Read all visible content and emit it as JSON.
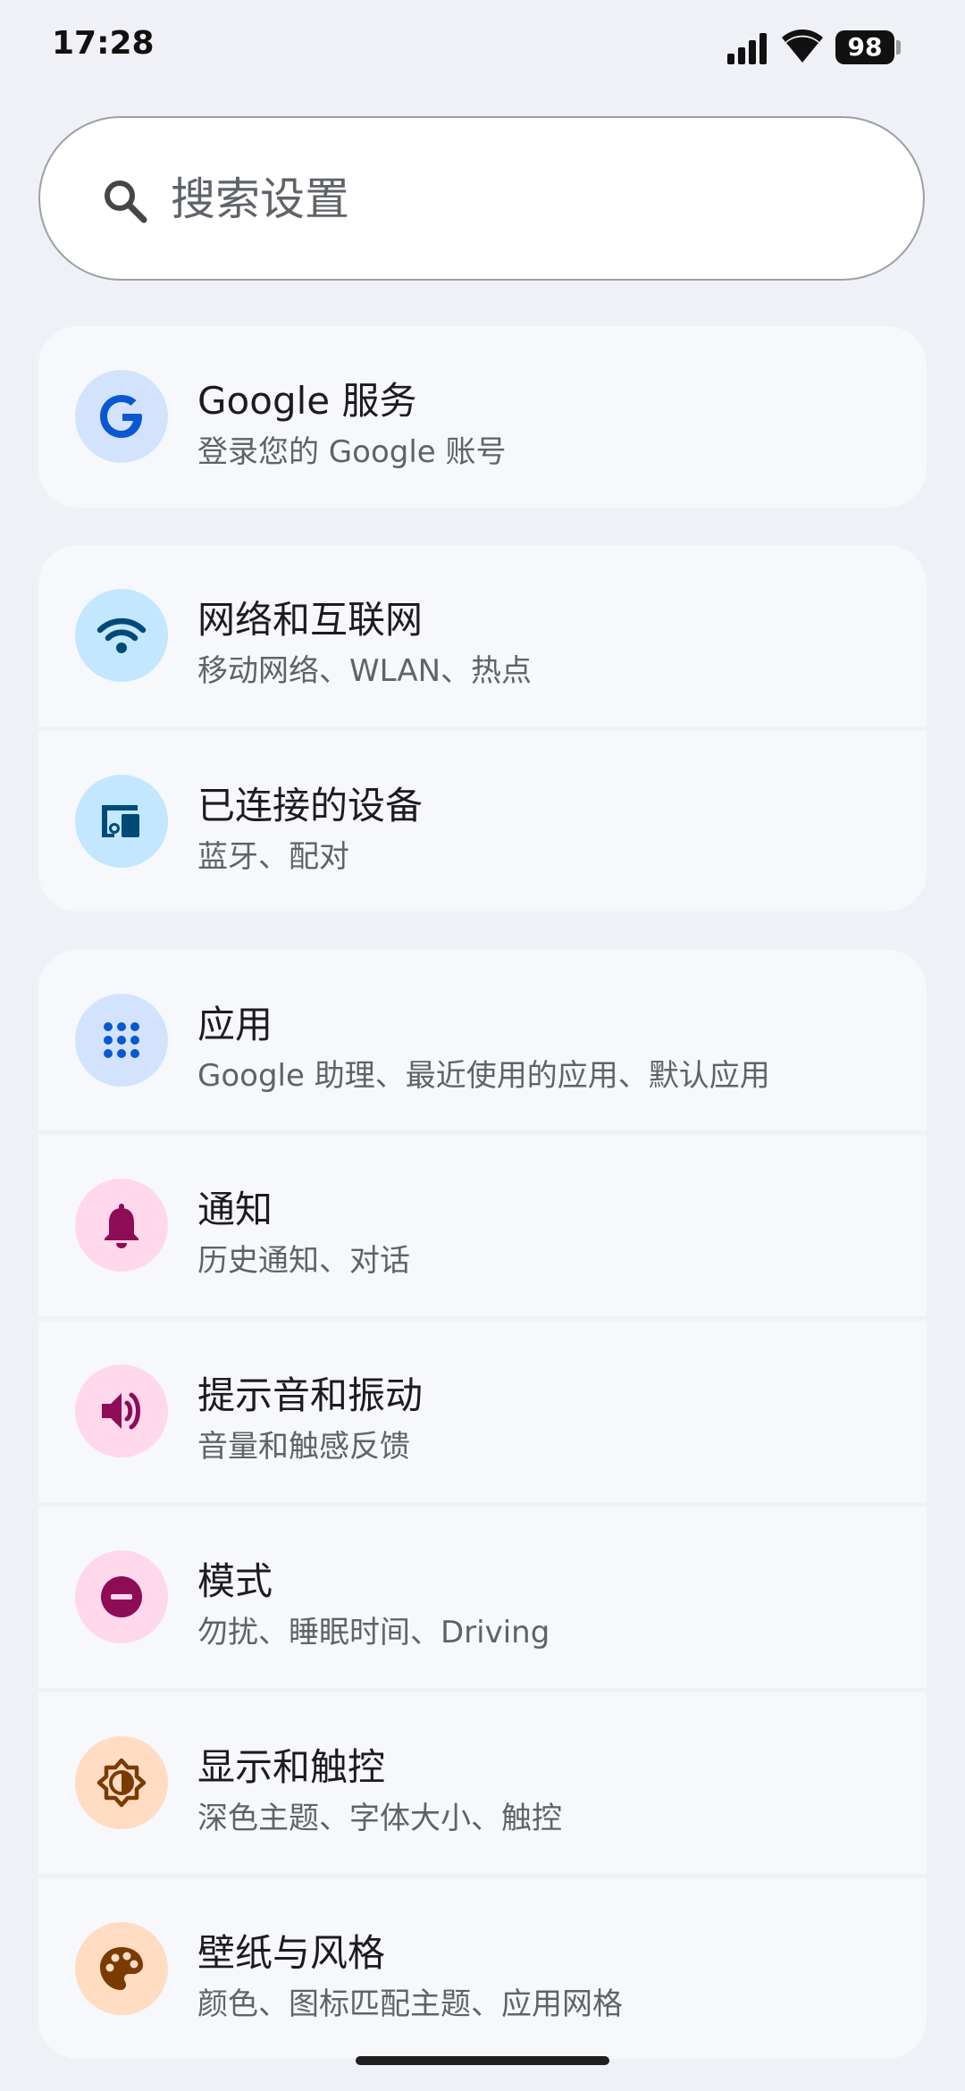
{
  "status_bar": {
    "time": "17:28",
    "battery_level": "98",
    "signal_bars": 4,
    "wifi": "full"
  },
  "search": {
    "placeholder": "搜索设置"
  },
  "settings": {
    "google": {
      "title": "Google 服务",
      "subtitle": "登录您的 Google 账号",
      "icon": "google-g-icon",
      "icon_bg": "#d3e3fd",
      "icon_color": "#0b57d0"
    },
    "network": {
      "title": "网络和互联网",
      "subtitle": "移动网络、WLAN、热点",
      "icon": "wifi-icon",
      "icon_bg": "#c2e7ff",
      "icon_color": "#004a77"
    },
    "connected_devices": {
      "title": "已连接的设备",
      "subtitle": "蓝牙、配对",
      "icon": "devices-icon",
      "icon_bg": "#c2e7ff",
      "icon_color": "#004a77"
    },
    "apps": {
      "title": "应用",
      "subtitle": "Google 助理、最近使用的应用、默认应用",
      "icon": "apps-grid-icon",
      "icon_bg": "#d3e3fd",
      "icon_color": "#0b57d0"
    },
    "notifications": {
      "title": "通知",
      "subtitle": "历史通知、对话",
      "icon": "bell-icon",
      "icon_bg": "#ffd8ec",
      "icon_color": "#8e0b56"
    },
    "sound": {
      "title": "提示音和振动",
      "subtitle": "音量和触感反馈",
      "icon": "volume-icon",
      "icon_bg": "#ffd8ec",
      "icon_color": "#8e0b56"
    },
    "modes": {
      "title": "模式",
      "subtitle": "勿扰、睡眠时间、Driving",
      "icon": "dnd-icon",
      "icon_bg": "#ffd8ec",
      "icon_color": "#8e0b56"
    },
    "display": {
      "title": "显示和触控",
      "subtitle": "深色主题、字体大小、触控",
      "icon": "brightness-icon",
      "icon_bg": "#ffdcc2",
      "icon_color": "#7a3a00"
    },
    "wallpaper": {
      "title": "壁纸与风格",
      "subtitle": "颜色、图标匹配主题、应用网格",
      "icon": "palette-icon",
      "icon_bg": "#ffdcc2",
      "icon_color": "#7a3a00"
    }
  }
}
